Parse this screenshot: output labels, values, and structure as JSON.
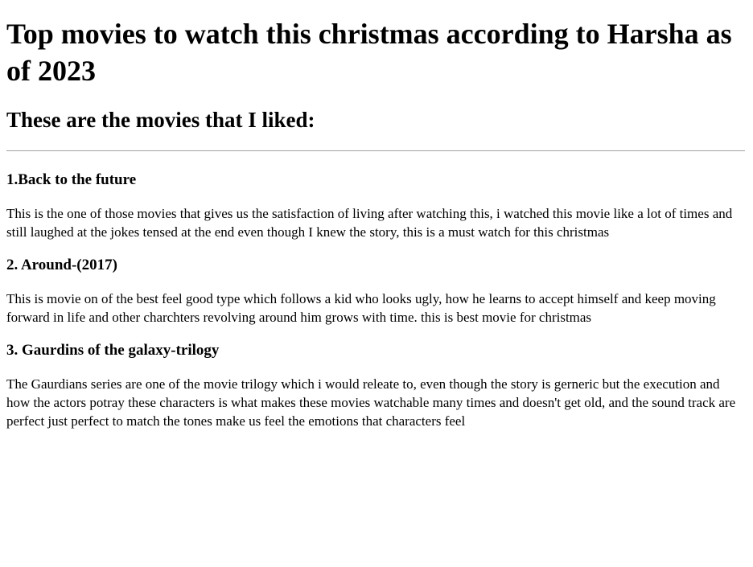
{
  "page": {
    "title": "Top movies to watch this christmas according to Harsha as of 2023",
    "subtitle": "These are the movies that I liked:"
  },
  "movies": [
    {
      "heading": "1.Back to the future",
      "description": "This is the one of those movies that gives us the satisfaction of living after watching this, i watched this movie like a lot of times and still laughed at the jokes tensed at the end even though I knew the story, this is a must watch for this christmas"
    },
    {
      "heading": "2. Around-(2017)",
      "description": "This is movie on of the best feel good type which follows a kid who looks ugly, how he learns to accept himself and keep moving forward in life and other charchters revolving around him grows with time. this is best movie for christmas"
    },
    {
      "heading": "3. Gaurdins of the galaxy-trilogy",
      "description": "The Gaurdians series are one of the movie trilogy which i would releate to, even though the story is gerneric but the execution and how the actors potray these characters is what makes these movies watchable many times and doesn't get old, and the sound track are perfect just perfect to match the tones make us feel the emotions that characters feel"
    }
  ]
}
